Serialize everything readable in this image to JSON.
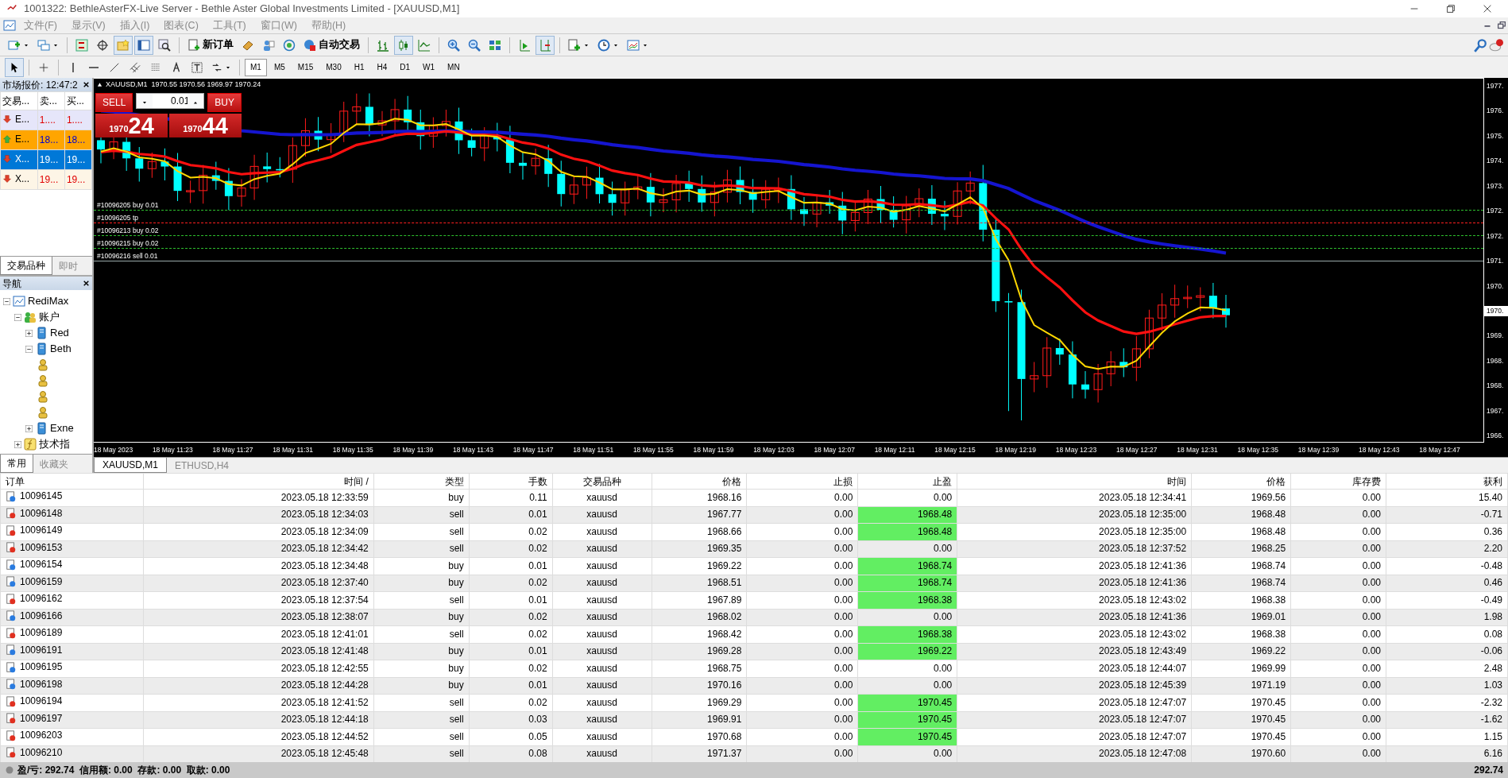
{
  "window": {
    "title": "1001322: BethleAsterFX-Live Server - Bethle Aster Global Investments Limited - [XAUUSD,M1]"
  },
  "menu": [
    "文件(F)",
    "显示(V)",
    "插入(I)",
    "图表(C)",
    "工具(T)",
    "窗口(W)",
    "帮助(H)"
  ],
  "toolbar": [
    {
      "kind": "icon",
      "pressed": false
    },
    {
      "kind": "icon",
      "pressed": false
    },
    {
      "kind": "sep"
    },
    {
      "kind": "icon",
      "pressed": false
    },
    {
      "kind": "icon",
      "pressed": false
    },
    {
      "kind": "icon",
      "pressed": true
    },
    {
      "kind": "icon",
      "pressed": true
    },
    {
      "kind": "icon",
      "pressed": false
    },
    {
      "kind": "sep"
    },
    {
      "kind": "text",
      "label": "新订单",
      "pressed": false
    },
    {
      "kind": "icon",
      "pressed": false
    },
    {
      "kind": "icon",
      "pressed": false
    },
    {
      "kind": "icon",
      "pressed": false
    },
    {
      "kind": "text",
      "label": "自动交易",
      "pressed": false
    },
    {
      "kind": "sep"
    },
    {
      "kind": "icon",
      "pressed": false
    },
    {
      "kind": "icon",
      "pressed": true
    },
    {
      "kind": "icon",
      "pressed": false
    },
    {
      "kind": "sep"
    },
    {
      "kind": "icon",
      "pressed": false
    },
    {
      "kind": "icon",
      "pressed": false
    },
    {
      "kind": "icon",
      "pressed": false
    },
    {
      "kind": "sep"
    },
    {
      "kind": "icon",
      "pressed": false
    },
    {
      "kind": "icon",
      "pressed": true
    },
    {
      "kind": "sep"
    },
    {
      "kind": "icon",
      "pressed": false
    },
    {
      "kind": "icon",
      "pressed": false
    },
    {
      "kind": "icon",
      "pressed": false
    }
  ],
  "drawing_tools": [
    {
      "pressed": true
    },
    {
      "pressed": false
    },
    {
      "pressed": false
    },
    {
      "pressed": false
    },
    {
      "pressed": false
    },
    {
      "pressed": false
    },
    {
      "pressed": false
    },
    {
      "pressed": false
    },
    {
      "pressed": false
    },
    {
      "pressed": false
    }
  ],
  "timeframes": [
    {
      "label": "M1",
      "selected": true
    },
    {
      "label": "M5",
      "selected": false
    },
    {
      "label": "M15",
      "selected": false
    },
    {
      "label": "M30",
      "selected": false
    },
    {
      "label": "H1",
      "selected": false
    },
    {
      "label": "H4",
      "selected": false
    },
    {
      "label": "D1",
      "selected": false
    },
    {
      "label": "W1",
      "selected": false
    },
    {
      "label": "MN",
      "selected": false
    }
  ],
  "market_watch": {
    "title": "市场报价: 12:47:2",
    "columns": [
      "交易...",
      "卖...",
      "买..."
    ],
    "rows": [
      {
        "kind": "down",
        "color": "#e6e6fa",
        "selected": false,
        "cells": [
          "E...",
          "1....",
          "1...."
        ]
      },
      {
        "kind": "up",
        "color": "#ffa500",
        "selected": false,
        "cells": [
          "E...",
          "18...",
          "18..."
        ]
      },
      {
        "kind": "down",
        "color": "#0078d7",
        "selected": true,
        "cells": [
          "X...",
          "19...",
          "19..."
        ]
      },
      {
        "kind": "down",
        "color": "#fdf5e6",
        "selected": false,
        "cells": [
          "X...",
          "19...",
          "19..."
        ]
      }
    ],
    "tabs": [
      {
        "label": "交易品种",
        "selected": true
      },
      {
        "label": "即时",
        "selected": false
      }
    ]
  },
  "navigator": {
    "title": "导航",
    "tree": [
      {
        "kind": "terminal",
        "label": "RediMax",
        "expanded": true,
        "children": [
          {
            "kind": "accounts",
            "label": "账户",
            "expanded": true,
            "children": [
              {
                "kind": "server",
                "label": "Red",
                "expanded": false
              },
              {
                "kind": "server",
                "label": "Beth",
                "expanded": true,
                "children": [
                  {
                    "kind": "account"
                  },
                  {
                    "kind": "account"
                  },
                  {
                    "kind": "account"
                  },
                  {
                    "kind": "account"
                  }
                ]
              },
              {
                "kind": "server",
                "label": "Exne",
                "expanded": false
              }
            ]
          },
          {
            "kind": "indicators",
            "label": "技术指",
            "expanded": false
          }
        ]
      }
    ],
    "tabs": [
      {
        "label": "常用",
        "selected": true
      },
      {
        "label": "收藏夹",
        "selected": false
      }
    ]
  },
  "chart": {
    "header": "XAUUSD,M1  1970.55 1970.56 1969.97 1970.24",
    "one_click": {
      "sell_label": "SELL",
      "buy_label": "BUY",
      "lots": "0.01",
      "sell_big": "1970",
      "sell_small": "24",
      "buy_big": "1970",
      "buy_small": "44"
    },
    "order_lines": [
      {
        "kind": "buy",
        "label": "#10096205 buy 0.01"
      },
      {
        "kind": "tp",
        "label": "#10096205 tp"
      },
      {
        "kind": "buy",
        "label": "#10096213 buy 0.02"
      },
      {
        "kind": "buy",
        "label": "#10096215 buy 0.02"
      },
      {
        "kind": "sell",
        "label": "#10096216 sell 0.01"
      }
    ],
    "price_axis": [
      {
        "label": "1977.",
        "current": false
      },
      {
        "label": "1976.",
        "current": false
      },
      {
        "label": "1975.",
        "current": false
      },
      {
        "label": "1974.",
        "current": false
      },
      {
        "label": "1973.",
        "current": false
      },
      {
        "label": "1972.",
        "current": false
      },
      {
        "label": "1972.",
        "current": false
      },
      {
        "label": "1971.",
        "current": false
      },
      {
        "label": "1970.",
        "current": false
      },
      {
        "label": "1970.",
        "current": true
      },
      {
        "label": "1969.",
        "current": false
      },
      {
        "label": "1968.",
        "current": false
      },
      {
        "label": "1968.",
        "current": false
      },
      {
        "label": "1967.",
        "current": false
      },
      {
        "label": "1966.",
        "current": false
      }
    ],
    "time_axis": [
      "18 May 2023",
      "18 May 11:23",
      "18 May 11:27",
      "18 May 11:31",
      "18 May 11:35",
      "18 May 11:39",
      "18 May 11:43",
      "18 May 11:47",
      "18 May 11:51",
      "18 May 11:55",
      "18 May 11:59",
      "18 May 12:03",
      "18 May 12:07",
      "18 May 12:11",
      "18 May 12:15",
      "18 May 12:19",
      "18 May 12:23",
      "18 May 12:27",
      "18 May 12:31",
      "18 May 12:35",
      "18 May 12:39",
      "18 May 12:43",
      "18 May 12:47"
    ]
  },
  "chart_tabs": [
    {
      "label": "XAUUSD,M1",
      "selected": true
    },
    {
      "label": "ETHUSD,H4",
      "selected": false
    }
  ],
  "history": {
    "columns": [
      "订单",
      "时间 /",
      "类型",
      "手数",
      "交易品种",
      "价格",
      "止损",
      "止盈",
      "时间",
      "价格",
      "库存费",
      "获利"
    ],
    "rows": [
      {
        "kind": "buy",
        "tp_hit": false,
        "cells": [
          "10096145",
          "2023.05.18 12:33:59",
          "buy",
          "0.11",
          "xauusd",
          "1968.16",
          "0.00",
          "0.00",
          "2023.05.18 12:34:41",
          "1969.56",
          "0.00",
          "15.40"
        ]
      },
      {
        "kind": "sell",
        "tp_hit": true,
        "cells": [
          "10096148",
          "2023.05.18 12:34:03",
          "sell",
          "0.01",
          "xauusd",
          "1967.77",
          "0.00",
          "1968.48",
          "2023.05.18 12:35:00",
          "1968.48",
          "0.00",
          "-0.71"
        ]
      },
      {
        "kind": "sell",
        "tp_hit": true,
        "cells": [
          "10096149",
          "2023.05.18 12:34:09",
          "sell",
          "0.02",
          "xauusd",
          "1968.66",
          "0.00",
          "1968.48",
          "2023.05.18 12:35:00",
          "1968.48",
          "0.00",
          "0.36"
        ]
      },
      {
        "kind": "sell",
        "tp_hit": false,
        "cells": [
          "10096153",
          "2023.05.18 12:34:42",
          "sell",
          "0.02",
          "xauusd",
          "1969.35",
          "0.00",
          "0.00",
          "2023.05.18 12:37:52",
          "1968.25",
          "0.00",
          "2.20"
        ]
      },
      {
        "kind": "buy",
        "tp_hit": true,
        "cells": [
          "10096154",
          "2023.05.18 12:34:48",
          "buy",
          "0.01",
          "xauusd",
          "1969.22",
          "0.00",
          "1968.74",
          "2023.05.18 12:41:36",
          "1968.74",
          "0.00",
          "-0.48"
        ]
      },
      {
        "kind": "buy",
        "tp_hit": true,
        "cells": [
          "10096159",
          "2023.05.18 12:37:40",
          "buy",
          "0.02",
          "xauusd",
          "1968.51",
          "0.00",
          "1968.74",
          "2023.05.18 12:41:36",
          "1968.74",
          "0.00",
          "0.46"
        ]
      },
      {
        "kind": "sell",
        "tp_hit": true,
        "cells": [
          "10096162",
          "2023.05.18 12:37:54",
          "sell",
          "0.01",
          "xauusd",
          "1967.89",
          "0.00",
          "1968.38",
          "2023.05.18 12:43:02",
          "1968.38",
          "0.00",
          "-0.49"
        ]
      },
      {
        "kind": "buy",
        "tp_hit": false,
        "cells": [
          "10096166",
          "2023.05.18 12:38:07",
          "buy",
          "0.02",
          "xauusd",
          "1968.02",
          "0.00",
          "0.00",
          "2023.05.18 12:41:36",
          "1969.01",
          "0.00",
          "1.98"
        ]
      },
      {
        "kind": "sell",
        "tp_hit": true,
        "cells": [
          "10096189",
          "2023.05.18 12:41:01",
          "sell",
          "0.02",
          "xauusd",
          "1968.42",
          "0.00",
          "1968.38",
          "2023.05.18 12:43:02",
          "1968.38",
          "0.00",
          "0.08"
        ]
      },
      {
        "kind": "buy",
        "tp_hit": true,
        "cells": [
          "10096191",
          "2023.05.18 12:41:48",
          "buy",
          "0.01",
          "xauusd",
          "1969.28",
          "0.00",
          "1969.22",
          "2023.05.18 12:43:49",
          "1969.22",
          "0.00",
          "-0.06"
        ]
      },
      {
        "kind": "buy",
        "tp_hit": false,
        "cells": [
          "10096195",
          "2023.05.18 12:42:55",
          "buy",
          "0.02",
          "xauusd",
          "1968.75",
          "0.00",
          "0.00",
          "2023.05.18 12:44:07",
          "1969.99",
          "0.00",
          "2.48"
        ]
      },
      {
        "kind": "buy",
        "tp_hit": false,
        "cells": [
          "10096198",
          "2023.05.18 12:44:28",
          "buy",
          "0.01",
          "xauusd",
          "1970.16",
          "0.00",
          "0.00",
          "2023.05.18 12:45:39",
          "1971.19",
          "0.00",
          "1.03"
        ]
      },
      {
        "kind": "sell",
        "tp_hit": true,
        "cells": [
          "10096194",
          "2023.05.18 12:41:52",
          "sell",
          "0.02",
          "xauusd",
          "1969.29",
          "0.00",
          "1970.45",
          "2023.05.18 12:47:07",
          "1970.45",
          "0.00",
          "-2.32"
        ]
      },
      {
        "kind": "sell",
        "tp_hit": true,
        "cells": [
          "10096197",
          "2023.05.18 12:44:18",
          "sell",
          "0.03",
          "xauusd",
          "1969.91",
          "0.00",
          "1970.45",
          "2023.05.18 12:47:07",
          "1970.45",
          "0.00",
          "-1.62"
        ]
      },
      {
        "kind": "sell",
        "tp_hit": true,
        "cells": [
          "10096203",
          "2023.05.18 12:44:52",
          "sell",
          "0.05",
          "xauusd",
          "1970.68",
          "0.00",
          "1970.45",
          "2023.05.18 12:47:07",
          "1970.45",
          "0.00",
          "1.15"
        ]
      },
      {
        "kind": "sell",
        "tp_hit": false,
        "cells": [
          "10096210",
          "2023.05.18 12:45:48",
          "sell",
          "0.08",
          "xauusd",
          "1971.37",
          "0.00",
          "0.00",
          "2023.05.18 12:47:08",
          "1970.60",
          "0.00",
          "6.16"
        ]
      }
    ]
  },
  "status_bar": {
    "summary": "盈/亏: 292.74  信用额: 0.00  存款: 0.00  取款: 0.00",
    "total": "292.74"
  }
}
